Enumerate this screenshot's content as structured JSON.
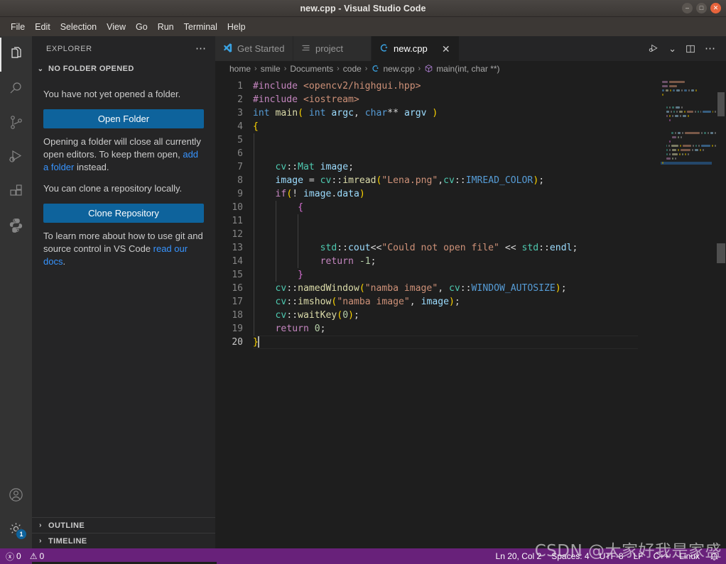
{
  "window": {
    "title": "new.cpp - Visual Studio Code",
    "controls": {
      "minimize": "–",
      "maximize": "□",
      "close": "✕"
    }
  },
  "menubar": {
    "items": [
      "File",
      "Edit",
      "Selection",
      "View",
      "Go",
      "Run",
      "Terminal",
      "Help"
    ]
  },
  "activitybar": {
    "top": [
      {
        "name": "explorer-icon",
        "label": "Explorer",
        "active": true
      },
      {
        "name": "search-icon",
        "label": "Search",
        "active": false
      },
      {
        "name": "source-control-icon",
        "label": "Source Control",
        "active": false
      },
      {
        "name": "run-debug-icon",
        "label": "Run and Debug",
        "active": false
      },
      {
        "name": "extensions-icon",
        "label": "Extensions",
        "active": false
      },
      {
        "name": "python-icon",
        "label": "Python",
        "active": false
      }
    ],
    "bottom": [
      {
        "name": "account-icon",
        "label": "Accounts",
        "badge": ""
      },
      {
        "name": "settings-gear-icon",
        "label": "Manage",
        "badge": "1"
      }
    ]
  },
  "sidebar": {
    "title": "EXPLORER",
    "more_actions": "⋯",
    "section": {
      "label": "NO FOLDER OPENED",
      "expanded_chevron": "⌄"
    },
    "paragraph1": "You have not yet opened a folder.",
    "open_folder_button": "Open Folder",
    "paragraph2_a": "Opening a folder will close all currently open editors. To keep them open, ",
    "paragraph2_link": "add a folder",
    "paragraph2_b": " instead.",
    "paragraph3": "You can clone a repository locally.",
    "clone_repository_button": "Clone Repository",
    "paragraph4_a": "To learn more about how to use git and source control in VS Code ",
    "paragraph4_link": "read our docs",
    "paragraph4_b": ".",
    "panels": [
      {
        "label": "OUTLINE",
        "chevron": "›"
      },
      {
        "label": "TIMELINE",
        "chevron": "›"
      }
    ]
  },
  "tabs": [
    {
      "label": "Get Started",
      "icon": "vscode-logo-icon",
      "active": false,
      "closeable": false
    },
    {
      "label": "project",
      "icon": "settings-lines-icon",
      "active": false,
      "closeable": false
    },
    {
      "label": "new.cpp",
      "icon": "cpp-file-icon",
      "active": true,
      "closeable": true,
      "close": "✕"
    }
  ],
  "tab_actions": [
    {
      "name": "run-or-debug-icon",
      "label": "Run or Debug"
    },
    {
      "name": "chevron-down-icon",
      "label": "More run options",
      "glyph": "⌄"
    },
    {
      "name": "split-editor-icon",
      "label": "Split Editor"
    },
    {
      "name": "more-actions-icon",
      "label": "More Actions",
      "glyph": "⋯"
    }
  ],
  "breadcrumb": {
    "separator": "›",
    "items": [
      {
        "label": "home",
        "icon": ""
      },
      {
        "label": "smile",
        "icon": ""
      },
      {
        "label": "Documents",
        "icon": ""
      },
      {
        "label": "code",
        "icon": ""
      },
      {
        "label": "new.cpp",
        "icon": "cpp-file-icon"
      },
      {
        "label": "main(int, char **)",
        "icon": "symbol-method-icon"
      }
    ]
  },
  "editor": {
    "language": "cpp",
    "total_lines": 20,
    "current_line": 20,
    "lines": [
      {
        "n": 1,
        "tokens": [
          {
            "t": "pre",
            "s": "#include"
          },
          {
            "t": "pln",
            "s": " "
          },
          {
            "t": "str",
            "s": "<opencv2/highgui.hpp>"
          }
        ],
        "indent": 0
      },
      {
        "n": 2,
        "tokens": [
          {
            "t": "pre",
            "s": "#include"
          },
          {
            "t": "pln",
            "s": " "
          },
          {
            "t": "str",
            "s": "<iostream>"
          }
        ],
        "indent": 0
      },
      {
        "n": 3,
        "tokens": [
          {
            "t": "kw",
            "s": "int"
          },
          {
            "t": "pln",
            "s": " "
          },
          {
            "t": "fn",
            "s": "main"
          },
          {
            "t": "br1",
            "s": "("
          },
          {
            "t": "pln",
            "s": " "
          },
          {
            "t": "kw",
            "s": "int"
          },
          {
            "t": "pln",
            "s": " "
          },
          {
            "t": "var",
            "s": "argc"
          },
          {
            "t": "pln",
            "s": ", "
          },
          {
            "t": "kw",
            "s": "char"
          },
          {
            "t": "op",
            "s": "**"
          },
          {
            "t": "pln",
            "s": " "
          },
          {
            "t": "var",
            "s": "argv"
          },
          {
            "t": "pln",
            "s": " "
          },
          {
            "t": "br1",
            "s": ")"
          }
        ],
        "indent": 0
      },
      {
        "n": 4,
        "tokens": [
          {
            "t": "br1",
            "s": "{"
          }
        ],
        "indent": 0
      },
      {
        "n": 5,
        "tokens": [],
        "indent": 1
      },
      {
        "n": 6,
        "tokens": [],
        "indent": 1
      },
      {
        "n": 7,
        "tokens": [
          {
            "t": "pln",
            "s": "    "
          },
          {
            "t": "type",
            "s": "cv"
          },
          {
            "t": "op",
            "s": "::"
          },
          {
            "t": "type",
            "s": "Mat"
          },
          {
            "t": "pln",
            "s": " "
          },
          {
            "t": "var",
            "s": "image"
          },
          {
            "t": "pln",
            "s": ";"
          }
        ],
        "indent": 1
      },
      {
        "n": 8,
        "tokens": [
          {
            "t": "pln",
            "s": "    "
          },
          {
            "t": "var",
            "s": "image"
          },
          {
            "t": "pln",
            "s": " "
          },
          {
            "t": "op",
            "s": "="
          },
          {
            "t": "pln",
            "s": " "
          },
          {
            "t": "type",
            "s": "cv"
          },
          {
            "t": "op",
            "s": "::"
          },
          {
            "t": "fn",
            "s": "imread"
          },
          {
            "t": "br1",
            "s": "("
          },
          {
            "t": "str",
            "s": "\"Lena.png\""
          },
          {
            "t": "pln",
            "s": ","
          },
          {
            "t": "type",
            "s": "cv"
          },
          {
            "t": "op",
            "s": "::"
          },
          {
            "t": "kw",
            "s": "IMREAD_COLOR"
          },
          {
            "t": "br1",
            "s": ")"
          },
          {
            "t": "pln",
            "s": ";"
          }
        ],
        "indent": 1
      },
      {
        "n": 9,
        "tokens": [
          {
            "t": "pln",
            "s": "    "
          },
          {
            "t": "pre",
            "s": "if"
          },
          {
            "t": "br1",
            "s": "("
          },
          {
            "t": "op",
            "s": "!"
          },
          {
            "t": "pln",
            "s": " "
          },
          {
            "t": "var",
            "s": "image"
          },
          {
            "t": "pln",
            "s": "."
          },
          {
            "t": "var",
            "s": "data"
          },
          {
            "t": "br1",
            "s": ")"
          }
        ],
        "indent": 1
      },
      {
        "n": 10,
        "tokens": [
          {
            "t": "pln",
            "s": "        "
          },
          {
            "t": "br2",
            "s": "{"
          }
        ],
        "indent": 2
      },
      {
        "n": 11,
        "tokens": [],
        "indent": 3
      },
      {
        "n": 12,
        "tokens": [],
        "indent": 3
      },
      {
        "n": 13,
        "tokens": [
          {
            "t": "pln",
            "s": "            "
          },
          {
            "t": "type",
            "s": "std"
          },
          {
            "t": "op",
            "s": "::"
          },
          {
            "t": "var",
            "s": "cout"
          },
          {
            "t": "op",
            "s": "<<"
          },
          {
            "t": "str",
            "s": "\"Could not open file\""
          },
          {
            "t": "pln",
            "s": " "
          },
          {
            "t": "op",
            "s": "<<"
          },
          {
            "t": "pln",
            "s": " "
          },
          {
            "t": "type",
            "s": "std"
          },
          {
            "t": "op",
            "s": "::"
          },
          {
            "t": "var",
            "s": "endl"
          },
          {
            "t": "pln",
            "s": ";"
          }
        ],
        "indent": 3
      },
      {
        "n": 14,
        "tokens": [
          {
            "t": "pln",
            "s": "            "
          },
          {
            "t": "pre",
            "s": "return"
          },
          {
            "t": "pln",
            "s": " "
          },
          {
            "t": "num",
            "s": "-1"
          },
          {
            "t": "pln",
            "s": ";"
          }
        ],
        "indent": 3
      },
      {
        "n": 15,
        "tokens": [
          {
            "t": "pln",
            "s": "        "
          },
          {
            "t": "br2",
            "s": "}"
          }
        ],
        "indent": 2
      },
      {
        "n": 16,
        "tokens": [
          {
            "t": "pln",
            "s": "    "
          },
          {
            "t": "type",
            "s": "cv"
          },
          {
            "t": "op",
            "s": "::"
          },
          {
            "t": "fn",
            "s": "namedWindow"
          },
          {
            "t": "br1",
            "s": "("
          },
          {
            "t": "str",
            "s": "\"namba image\""
          },
          {
            "t": "pln",
            "s": ", "
          },
          {
            "t": "type",
            "s": "cv"
          },
          {
            "t": "op",
            "s": "::"
          },
          {
            "t": "kw",
            "s": "WINDOW_AUTOSIZE"
          },
          {
            "t": "br1",
            "s": ")"
          },
          {
            "t": "pln",
            "s": ";"
          }
        ],
        "indent": 1
      },
      {
        "n": 17,
        "tokens": [
          {
            "t": "pln",
            "s": "    "
          },
          {
            "t": "type",
            "s": "cv"
          },
          {
            "t": "op",
            "s": "::"
          },
          {
            "t": "fn",
            "s": "imshow"
          },
          {
            "t": "br1",
            "s": "("
          },
          {
            "t": "str",
            "s": "\"namba image\""
          },
          {
            "t": "pln",
            "s": ", "
          },
          {
            "t": "var",
            "s": "image"
          },
          {
            "t": "br1",
            "s": ")"
          },
          {
            "t": "pln",
            "s": ";"
          }
        ],
        "indent": 1
      },
      {
        "n": 18,
        "tokens": [
          {
            "t": "pln",
            "s": "    "
          },
          {
            "t": "type",
            "s": "cv"
          },
          {
            "t": "op",
            "s": "::"
          },
          {
            "t": "fn",
            "s": "waitKey"
          },
          {
            "t": "br1",
            "s": "("
          },
          {
            "t": "num",
            "s": "0"
          },
          {
            "t": "br1",
            "s": ")"
          },
          {
            "t": "pln",
            "s": ";"
          }
        ],
        "indent": 1
      },
      {
        "n": 19,
        "tokens": [
          {
            "t": "pln",
            "s": "    "
          },
          {
            "t": "pre",
            "s": "return"
          },
          {
            "t": "pln",
            "s": " "
          },
          {
            "t": "num",
            "s": "0"
          },
          {
            "t": "pln",
            "s": ";"
          }
        ],
        "indent": 1
      },
      {
        "n": 20,
        "tokens": [
          {
            "t": "br1",
            "s": "}"
          }
        ],
        "indent": 0,
        "cursor": true
      }
    ]
  },
  "statusbar": {
    "errors": "0",
    "warnings": "0",
    "error_icon": "ⓧ",
    "warning_icon": "⚠",
    "position": "Ln 20, Col 2",
    "indentation": "Spaces: 4",
    "encoding": "UTF-8",
    "eol": "LF",
    "language": "C++",
    "platform": "Linux",
    "bell_icon": "🔔"
  },
  "watermark": "CSDN @大家好我是家盛",
  "colors": {
    "statusbar_bg": "#68217a",
    "accent_button": "#0e639c",
    "link": "#3794ff",
    "editor_bg": "#1e1e1e",
    "sidebar_bg": "#252526",
    "activitybar_bg": "#333333",
    "titlebar_bg": "#3c3835"
  }
}
